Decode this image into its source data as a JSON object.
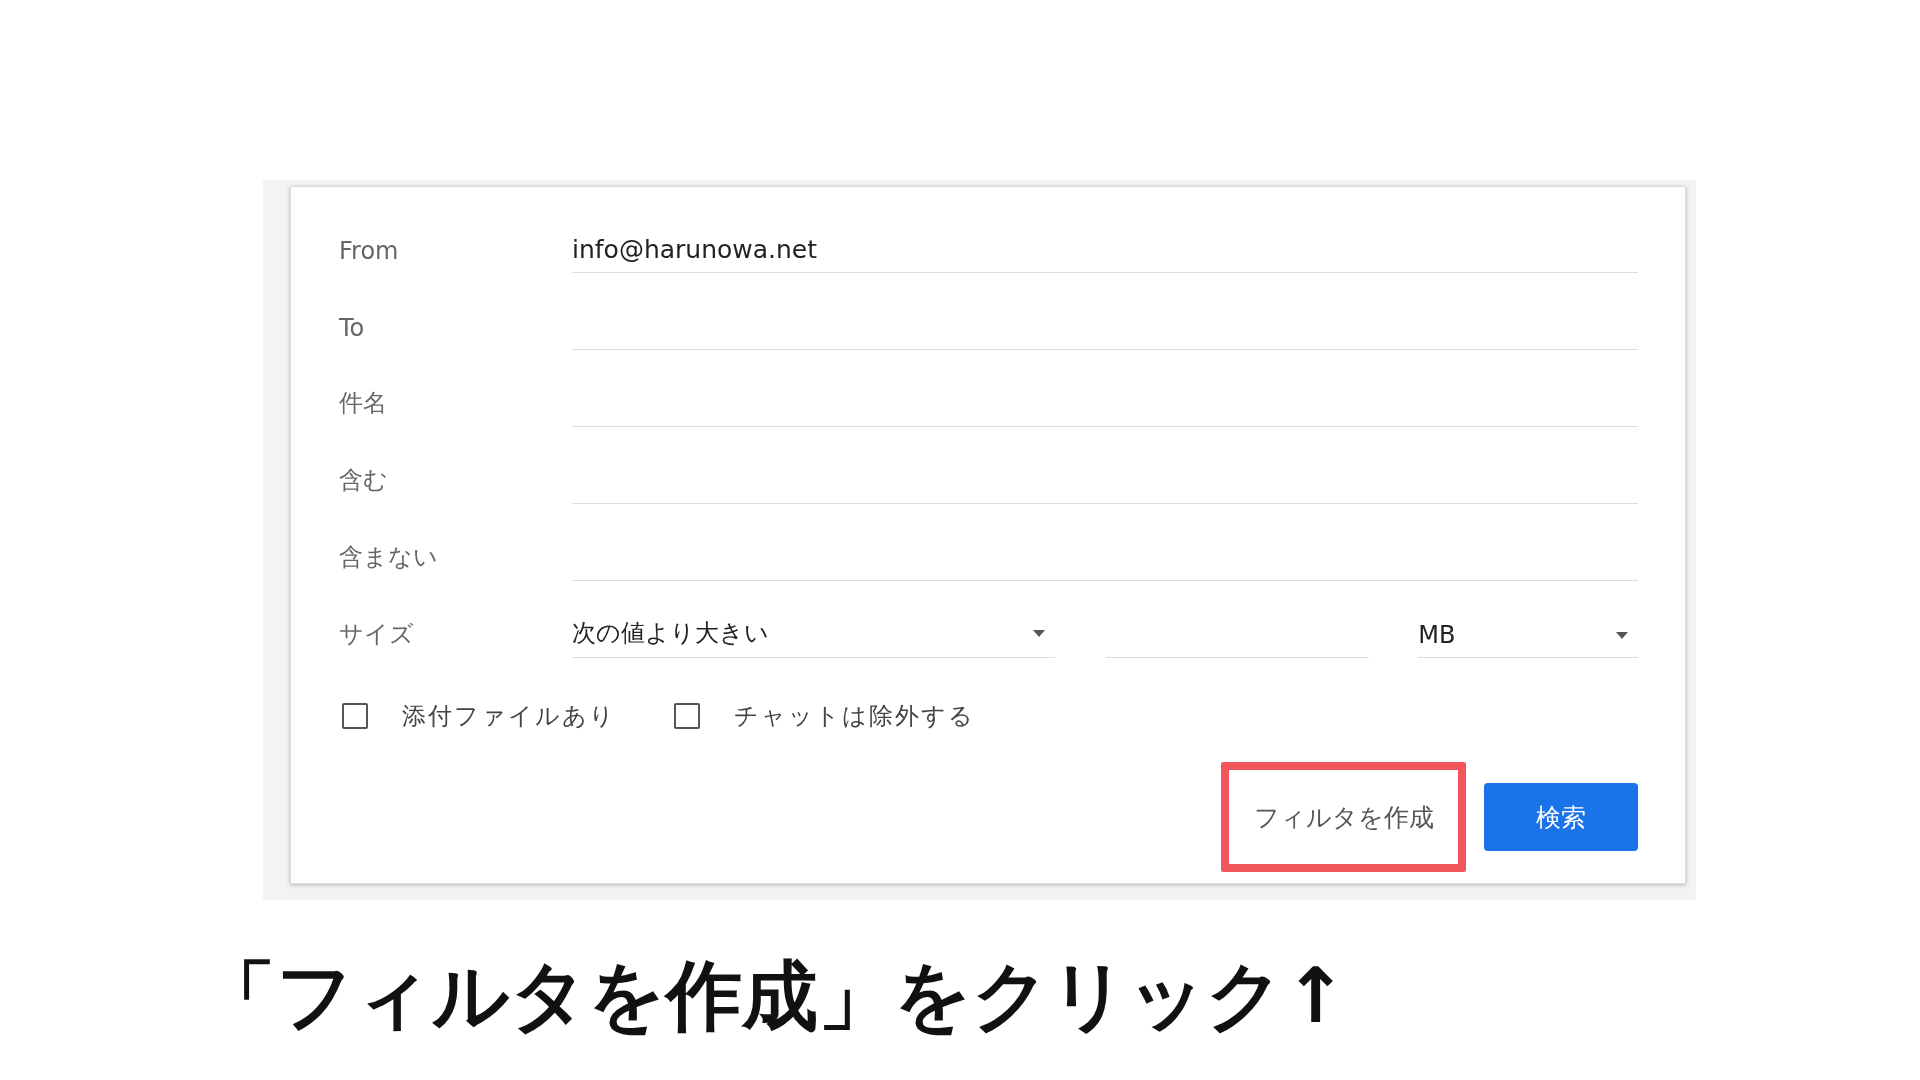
{
  "search_panel": {
    "fields": [
      {
        "kind": "text",
        "label": "From",
        "value": "info@harunowa.net"
      },
      {
        "kind": "text",
        "label": "To"
      },
      {
        "kind": "text",
        "label": "件名"
      },
      {
        "kind": "text",
        "label": "含む"
      },
      {
        "kind": "text",
        "label": "含まない"
      },
      {
        "kind": "size",
        "label": "サイズ",
        "comparison": "次の値より大きい",
        "unit": "MB"
      }
    ],
    "checkboxes": [
      {
        "label": "添付ファイルあり",
        "checked": false
      },
      {
        "label": "チャットは除外する",
        "checked": false
      }
    ],
    "buttons": [
      {
        "kind": "secondary",
        "label": "フィルタを作成",
        "highlighted": true
      },
      {
        "kind": "primary",
        "label": "検索",
        "highlighted": false
      }
    ]
  },
  "caption": "「フィルタを作成」をクリック↑"
}
